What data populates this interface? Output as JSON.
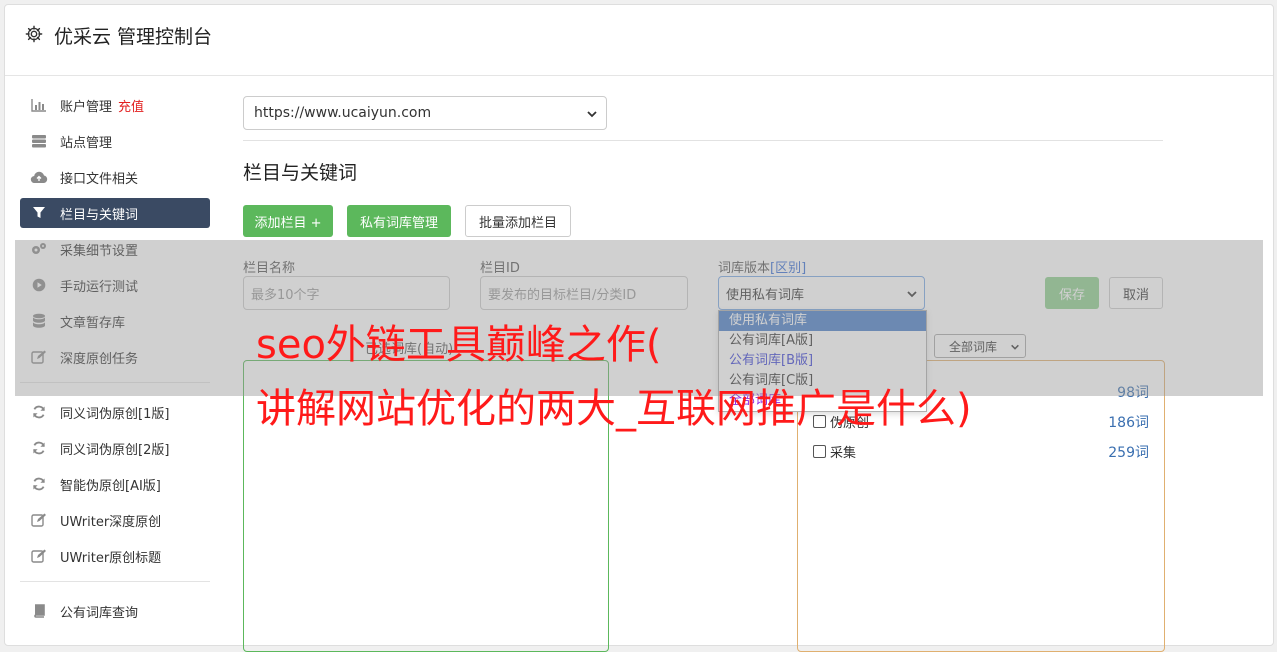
{
  "app": {
    "title": "优采云 管理控制台"
  },
  "sidebar": {
    "items": [
      {
        "label": "账户管理",
        "badge": "充值",
        "icon": "bar-chart-icon"
      },
      {
        "label": "站点管理",
        "icon": "server-icon"
      },
      {
        "label": "接口文件相关",
        "icon": "cloud-upload-icon"
      },
      {
        "label": "栏目与关键词",
        "icon": "filter-icon",
        "active": true
      },
      {
        "label": "采集细节设置",
        "icon": "gears-icon"
      },
      {
        "label": "手动运行测试",
        "icon": "play-icon"
      },
      {
        "label": "文章暂存库",
        "icon": "database-icon"
      },
      {
        "label": "深度原创任务",
        "icon": "edit-icon"
      }
    ],
    "items2": [
      {
        "label": "同义词伪原创[1版]",
        "icon": "refresh-icon"
      },
      {
        "label": "同义词伪原创[2版]",
        "icon": "refresh-icon"
      },
      {
        "label": "智能伪原创[AI版]",
        "icon": "refresh-icon"
      },
      {
        "label": "UWriter深度原创",
        "icon": "edit-icon"
      },
      {
        "label": "UWriter原创标题",
        "icon": "edit-icon"
      }
    ],
    "items3": [
      {
        "label": "公有词库查询",
        "icon": "book-icon"
      }
    ]
  },
  "main": {
    "site_select_value": "https://www.ucaiyun.com",
    "section_title": "栏目与关键词",
    "buttons": {
      "add_column": "添加栏目 +",
      "private_lib": "私有词库管理",
      "batch_add": "批量添加栏目"
    },
    "form": {
      "name_label": "栏目名称",
      "name_placeholder": "最多10个字",
      "id_label": "栏目ID",
      "id_placeholder": "要发布的目标栏目/分类ID",
      "lib_label": "词库版本",
      "lib_label_link": "[区别]",
      "lib_value": "使用私有词库",
      "save": "保存",
      "cancel": "取消"
    },
    "dropdown_options": [
      "使用私有词库",
      "公有词库[A版]",
      "公有词库[B版]",
      "公有词库[C版]",
      "全部词库"
    ],
    "partial_label": "已选词库(自动)",
    "filter_select": "全部词库",
    "library_list": [
      {
        "label": "",
        "count": "98词"
      },
      {
        "label": "伪原创",
        "count": "186词"
      },
      {
        "label": "采集",
        "count": "259词"
      }
    ]
  },
  "overlay": {
    "line1": "seo外链工具巅峰之作(",
    "line2": "讲解网站优化的两大_互联网推广是什么)"
  },
  "colors": {
    "accent_green": "#5cb85c",
    "nav_active": "#3a4a63",
    "overlay_text": "#ff1a1a",
    "badge_red": "#e21f1f"
  }
}
